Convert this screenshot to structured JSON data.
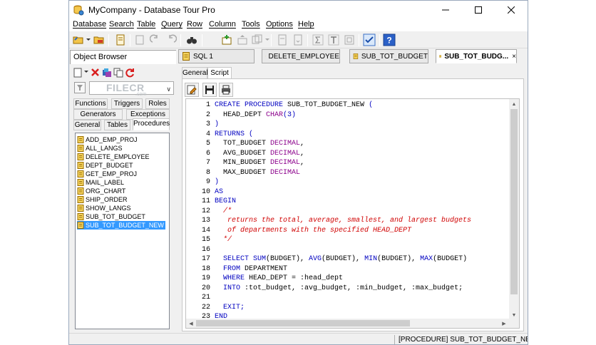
{
  "window": {
    "title": "MyCompany - Database Tour Pro"
  },
  "menu": [
    "Database",
    "Search",
    "Table",
    "Query",
    "Row",
    "Column",
    "Tools",
    "Options",
    "Help"
  ],
  "object_browser": {
    "title": "Object Browser",
    "close": "×",
    "watermark": "FILECR",
    "watermark_sub": ".com",
    "tabs_row1": [
      "Functions",
      "Triggers",
      "Roles"
    ],
    "tabs_row2": [
      "Generators",
      "Exceptions"
    ],
    "tabs_row3": [
      "General",
      "Tables",
      "Procedures"
    ],
    "active_tab": "Procedures",
    "items": [
      "ADD_EMP_PROJ",
      "ALL_LANGS",
      "DELETE_EMPLOYEE",
      "DEPT_BUDGET",
      "GET_EMP_PROJ",
      "MAIL_LABEL",
      "ORG_CHART",
      "SHIP_ORDER",
      "SHOW_LANGS",
      "SUB_TOT_BUDGET",
      "SUB_TOT_BUDGET_NEW"
    ],
    "selected_item": "SUB_TOT_BUDGET_NEW"
  },
  "doc_tabs": [
    "SQL 1",
    "DELETE_EMPLOYEE",
    "SUB_TOT_BUDGET",
    "SUB_TOT_BUDG..."
  ],
  "doc_tab_close": "×",
  "active_doc_tab": "SUB_TOT_BUDG...",
  "editor_tabs": [
    "General",
    "Script"
  ],
  "active_editor_tab": "Script",
  "code_lines": [
    {
      "n": "1",
      "parts": [
        {
          "c": "kw",
          "t": "CREATE PROCEDURE "
        },
        {
          "c": "",
          "t": "SUB_TOT_BUDGET_NEW "
        },
        {
          "c": "kw",
          "t": "("
        }
      ]
    },
    {
      "n": "2",
      "parts": [
        {
          "c": "",
          "t": "  HEAD_DEPT "
        },
        {
          "c": "ty",
          "t": "CHAR"
        },
        {
          "c": "kw",
          "t": "(3)"
        }
      ]
    },
    {
      "n": "3",
      "parts": [
        {
          "c": "kw",
          "t": ")"
        }
      ]
    },
    {
      "n": "4",
      "parts": [
        {
          "c": "kw",
          "t": "RETURNS ("
        }
      ]
    },
    {
      "n": "5",
      "parts": [
        {
          "c": "",
          "t": "  TOT_BUDGET "
        },
        {
          "c": "ty",
          "t": "DECIMAL"
        },
        {
          "c": "",
          "t": ","
        }
      ]
    },
    {
      "n": "6",
      "parts": [
        {
          "c": "",
          "t": "  AVG_BUDGET "
        },
        {
          "c": "ty",
          "t": "DECIMAL"
        },
        {
          "c": "",
          "t": ","
        }
      ]
    },
    {
      "n": "7",
      "parts": [
        {
          "c": "",
          "t": "  MIN_BUDGET "
        },
        {
          "c": "ty",
          "t": "DECIMAL"
        },
        {
          "c": "",
          "t": ","
        }
      ]
    },
    {
      "n": "8",
      "parts": [
        {
          "c": "",
          "t": "  MAX_BUDGET "
        },
        {
          "c": "ty",
          "t": "DECIMAL"
        }
      ]
    },
    {
      "n": "9",
      "parts": [
        {
          "c": "kw",
          "t": ")"
        }
      ]
    },
    {
      "n": "10",
      "parts": [
        {
          "c": "kw",
          "t": "AS"
        }
      ]
    },
    {
      "n": "11",
      "parts": [
        {
          "c": "kw",
          "t": "BEGIN"
        }
      ]
    },
    {
      "n": "12",
      "parts": [
        {
          "c": "cm",
          "t": "  /*"
        }
      ]
    },
    {
      "n": "13",
      "parts": [
        {
          "c": "cm",
          "t": "   returns the total, average, smallest, and largest budgets"
        }
      ]
    },
    {
      "n": "14",
      "parts": [
        {
          "c": "cm",
          "t": "   of departments with the specified HEAD_DEPT"
        }
      ]
    },
    {
      "n": "15",
      "parts": [
        {
          "c": "cm",
          "t": "  */"
        }
      ]
    },
    {
      "n": "16",
      "parts": []
    },
    {
      "n": "17",
      "parts": [
        {
          "c": "kw",
          "t": "  SELECT SUM"
        },
        {
          "c": "",
          "t": "(BUDGET), "
        },
        {
          "c": "kw",
          "t": "AVG"
        },
        {
          "c": "",
          "t": "(BUDGET), "
        },
        {
          "c": "kw",
          "t": "MIN"
        },
        {
          "c": "",
          "t": "(BUDGET), "
        },
        {
          "c": "kw",
          "t": "MAX"
        },
        {
          "c": "",
          "t": "(BUDGET)"
        }
      ]
    },
    {
      "n": "18",
      "parts": [
        {
          "c": "kw",
          "t": "  FROM "
        },
        {
          "c": "",
          "t": "DEPARTMENT"
        }
      ]
    },
    {
      "n": "19",
      "parts": [
        {
          "c": "kw",
          "t": "  WHERE "
        },
        {
          "c": "",
          "t": "HEAD_DEPT = :head_dept"
        }
      ]
    },
    {
      "n": "20",
      "parts": [
        {
          "c": "kw",
          "t": "  INTO "
        },
        {
          "c": "",
          "t": ":tot_budget, :avg_budget, :min_budget, :max_budget;"
        }
      ]
    },
    {
      "n": "21",
      "parts": []
    },
    {
      "n": "22",
      "parts": [
        {
          "c": "kw",
          "t": "  EXIT;"
        }
      ]
    },
    {
      "n": "23",
      "parts": [
        {
          "c": "kw",
          "t": "END"
        }
      ]
    }
  ],
  "status": {
    "text": "[PROCEDURE] SUB_TOT_BUDGET_NEW"
  },
  "colors": {
    "keyword": "#0000c0",
    "type": "#8b008b",
    "comment": "#d00000",
    "selection": "#3399ff"
  }
}
